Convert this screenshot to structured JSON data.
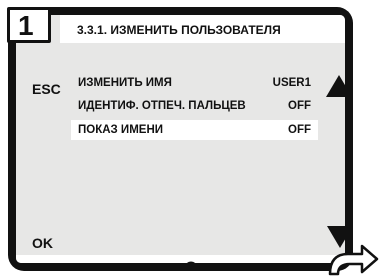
{
  "screen": {
    "step_number": "1",
    "title": "3.3.1. ИЗМЕНИТЬ ПОЛЬЗОВАТЕЛЯ",
    "esc_label": "ESC",
    "ok_label": "OK"
  },
  "menu": {
    "items": [
      {
        "label": "ИЗМЕНИТЬ ИМЯ",
        "value": "USER1"
      },
      {
        "label": "ИДЕНТИФ. ОТПЕЧ. ПАЛЬЦЕВ",
        "value": "OFF"
      },
      {
        "label": "ПОКАЗ ИМЕНИ",
        "value": "OFF"
      }
    ]
  },
  "icons": {
    "scroll_up": "triangle-up-icon",
    "scroll_down": "triangle-down-icon",
    "back": "circle-slash-icon",
    "exit": "curved-arrow-right-icon"
  },
  "colors": {
    "frame": "#111111",
    "screen_bg": "#e7e7e6",
    "highlight": "#ffffff"
  }
}
